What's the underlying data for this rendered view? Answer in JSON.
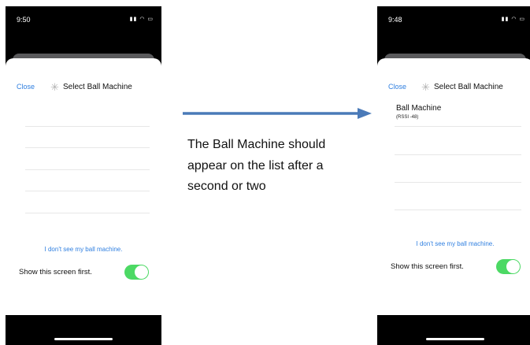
{
  "caption": {
    "line1": "The Ball Machine should",
    "line2": "appear on the list after a",
    "line3": "second or two"
  },
  "left_phone": {
    "status_time": "9:50",
    "status_icons": "signal-icon wifi-icon battery-icon",
    "close_label": "Close",
    "title": "Select Ball Machine",
    "link": "I don't see my ball machine.",
    "show_label": "Show this screen first.",
    "toggle_on": true
  },
  "right_phone": {
    "status_time": "9:48",
    "status_icons": "signal-icon wifi-icon battery-icon",
    "close_label": "Close",
    "title": "Select Ball Machine",
    "device": {
      "name": "Ball Machine",
      "rssi": "(RSSI -48)"
    },
    "link": "I don't see my ball machine.",
    "show_label": "Show this screen first.",
    "toggle_on": true
  },
  "colors": {
    "link_blue": "#2f7fe0",
    "toggle_green": "#4cd964",
    "arrow_blue": "#4a7ab8"
  }
}
